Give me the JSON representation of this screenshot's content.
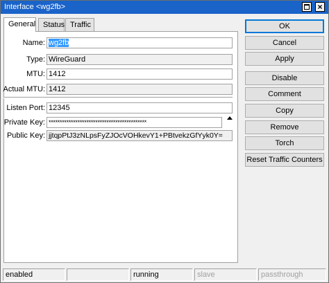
{
  "window": {
    "title": "Interface <wg2fb>"
  },
  "tabs": [
    {
      "label": "General"
    },
    {
      "label": "Status"
    },
    {
      "label": "Traffic"
    }
  ],
  "form": {
    "name_label": "Name:",
    "name_value": "wg2fb",
    "type_label": "Type:",
    "type_value": "WireGuard",
    "mtu_label": "MTU:",
    "mtu_value": "1412",
    "actual_mtu_label": "Actual MTU:",
    "actual_mtu_value": "1412",
    "listen_port_label": "Listen Port:",
    "listen_port_value": "12345",
    "private_key_label": "Private Key:",
    "private_key_value": "********************************************",
    "public_key_label": "Public Key:",
    "public_key_value": "jjtqpPtJ3zNLpsFyZJOcVOHkevY1+PBtvekzGfYyk0Y="
  },
  "buttons": {
    "ok": "OK",
    "cancel": "Cancel",
    "apply": "Apply",
    "disable": "Disable",
    "comment": "Comment",
    "copy": "Copy",
    "remove": "Remove",
    "torch": "Torch",
    "reset_traffic": "Reset Traffic Counters"
  },
  "statusbar": {
    "enabled": "enabled",
    "running": "running",
    "slave": "slave",
    "passthrough": "passthrough"
  },
  "icons": {
    "restore": "restore-icon",
    "close": "close-icon",
    "hide_toggle": "triangle-up-icon"
  }
}
